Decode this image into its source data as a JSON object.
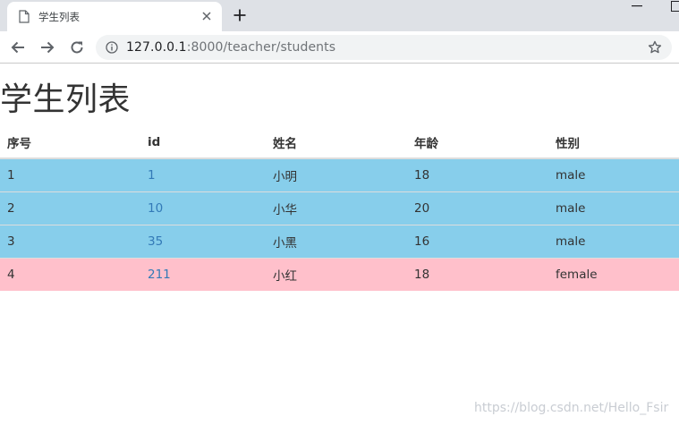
{
  "browser": {
    "tab_title": "学生列表",
    "url_host": "127.0.0.1",
    "url_rest": ":8000/teacher/students"
  },
  "page": {
    "title": "学生列表"
  },
  "table": {
    "headers": [
      "序号",
      "id",
      "姓名",
      "年龄",
      "性别"
    ],
    "rows": [
      {
        "index": "1",
        "id": "1",
        "name": "小明",
        "age": "18",
        "gender": "male"
      },
      {
        "index": "2",
        "id": "10",
        "name": "小华",
        "age": "20",
        "gender": "male"
      },
      {
        "index": "3",
        "id": "35",
        "name": "小黑",
        "age": "16",
        "gender": "male"
      },
      {
        "index": "4",
        "id": "211",
        "name": "小红",
        "age": "18",
        "gender": "female"
      }
    ],
    "row_colors": {
      "male": "#87ceeb",
      "female": "#ffc0cb"
    }
  },
  "watermark": "https://blog.csdn.net/Hello_Fsir",
  "icons": [
    "page-icon",
    "close-icon",
    "plus-icon",
    "minimize-icon",
    "maximize-icon",
    "back-arrow-icon",
    "forward-arrow-icon",
    "reload-icon",
    "info-icon",
    "star-icon"
  ]
}
